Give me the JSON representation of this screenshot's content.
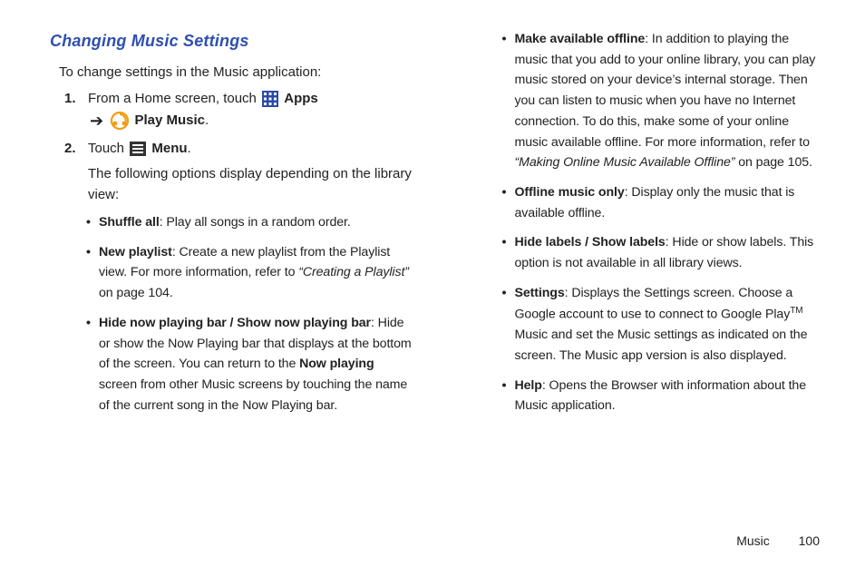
{
  "heading": "Changing Music Settings",
  "intro": "To change settings in the Music application:",
  "step1": {
    "num": "1.",
    "a": "From a Home screen, touch ",
    "apps": "Apps",
    "play": "Play Music",
    "dot": "."
  },
  "step2": {
    "num": "2.",
    "a": "Touch ",
    "menu": "Menu",
    "dot": ".",
    "after": "The following options display depending on the library view:"
  },
  "left_bullets": [
    {
      "lead": "Shuffle all",
      "rest": ": Play all songs in a random order."
    },
    {
      "lead": "New playlist",
      "rest_a": ": Create a new playlist from the Playlist view. For more information, refer to ",
      "ref": "“Creating a Playlist”",
      "rest_b": "  on page 104."
    },
    {
      "lead": "Hide now playing bar / Show now playing bar",
      "rest_a": ": Hide or show the Now Playing bar that displays at the bottom of the screen. You can return to the ",
      "mid_b": "Now playing",
      "rest_b": " screen from other Music screens by touching the name of the current song in the Now Playing bar."
    }
  ],
  "right_bullets": [
    {
      "lead": "Make available offline",
      "rest_a": ": In addition to playing the music that you add to your online library, you can play music stored on your device’s internal storage. Then you can listen to music when you have no Internet connection. To do this, make some of your online music available offline. For more information, refer to ",
      "ref": "“Making Online Music Available Offline”",
      "rest_b": "  on page 105."
    },
    {
      "lead": "Offline music only",
      "rest": ": Display only the music that is available offline."
    },
    {
      "lead": "Hide labels / Show labels",
      "rest": ": Hide or show labels. This option is not available in all library views."
    },
    {
      "lead": "Settings",
      "rest_a": ": Displays the Settings screen. Choose a Google account to use to connect to Google Play",
      "sup": "TM",
      "rest_b": " Music and set the Music settings as indicated on the screen. The Music app version is also displayed."
    },
    {
      "lead": "Help",
      "rest": ": Opens the Browser with information about the Music application."
    }
  ],
  "footer": {
    "chapter": "Music",
    "page": "100"
  }
}
